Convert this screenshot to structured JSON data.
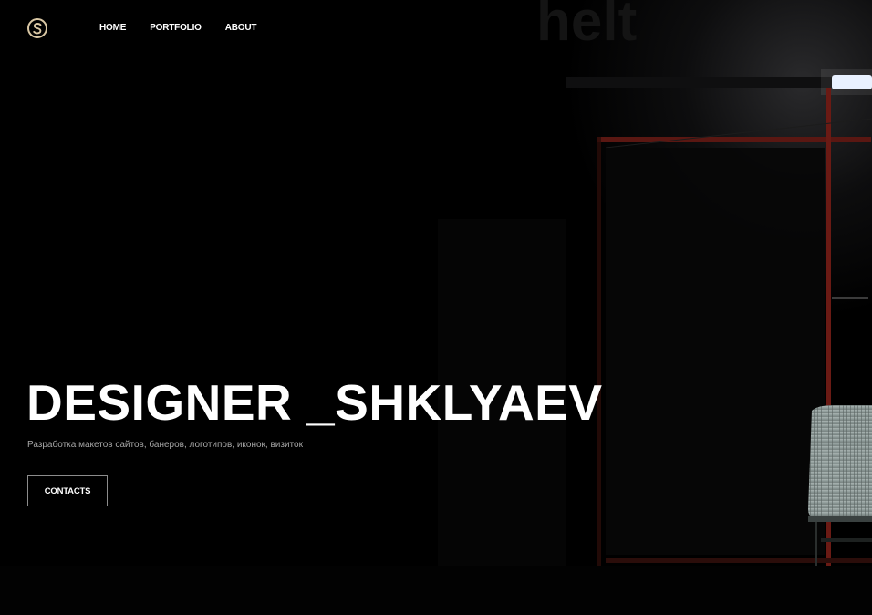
{
  "header": {
    "logo_letter": "S",
    "nav": [
      {
        "label": "HOME"
      },
      {
        "label": "PORTFOLIO"
      },
      {
        "label": "ABOUT"
      }
    ]
  },
  "hero": {
    "title": "DESIGNER _SHKLYAEV",
    "subtitle": "Разработка макетов сайтов, банеров, логотипов, иконок, визиток",
    "cta_label": "CONTACTS"
  },
  "background": {
    "description_icon": "night-bus-stop-photo",
    "accent_red": "#6a1a14",
    "lamp_color": "#e8f0ff",
    "seat_color": "#9aa7a5"
  }
}
